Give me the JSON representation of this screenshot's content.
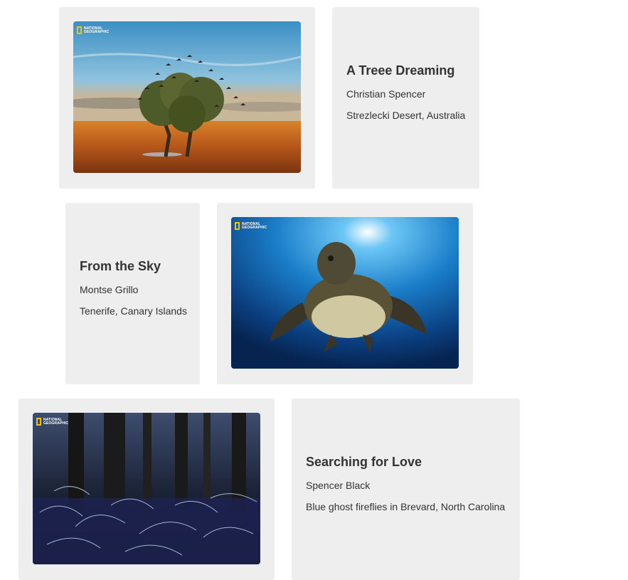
{
  "logo": {
    "line1": "NATIONAL",
    "line2": "GEOGRAPHIC"
  },
  "cards": [
    {
      "title": "A Treee Dreaming",
      "photographer": "Christian Spencer",
      "location": "Strezlecki Desert, Australia"
    },
    {
      "title": "From the Sky",
      "photographer": "Montse Grillo",
      "location": "Tenerife, Canary Islands"
    },
    {
      "title": "Searching for Love",
      "photographer": "Spencer Black",
      "location": "Blue ghost fireflies in Brevard, North Carolina"
    }
  ]
}
